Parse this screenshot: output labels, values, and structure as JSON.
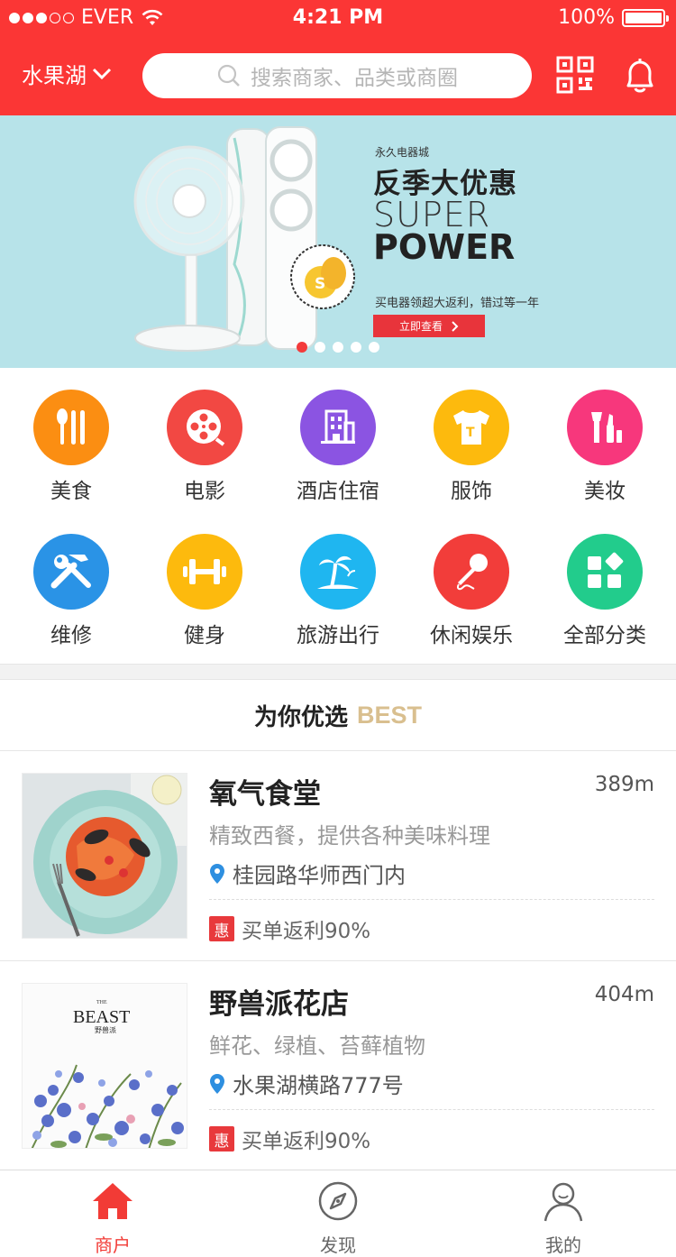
{
  "status_bar": {
    "carrier": "EVER",
    "time": "4:21 PM",
    "battery": "100%"
  },
  "header": {
    "city": "水果湖",
    "search_placeholder": "搜索商家、品类或商圈"
  },
  "banner": {
    "brand": "永久电器城",
    "title": "反季大优惠",
    "super": "SUPER",
    "power": "POWER",
    "desc": "买电器领超大返利，错过等一年",
    "button": "立即查看",
    "slide_count": 5,
    "active_slide": 1
  },
  "categories": [
    {
      "label": "美食",
      "icon": "cutlery-icon",
      "color": "#fb8e12"
    },
    {
      "label": "电影",
      "icon": "film-reel-icon",
      "color": "#f24843"
    },
    {
      "label": "酒店住宿",
      "icon": "building-icon",
      "color": "#8b54e2"
    },
    {
      "label": "服饰",
      "icon": "tshirt-icon",
      "color": "#fdba0d"
    },
    {
      "label": "美妆",
      "icon": "cosmetics-icon",
      "color": "#f7377c"
    },
    {
      "label": "维修",
      "icon": "tools-icon",
      "color": "#2a93e6"
    },
    {
      "label": "健身",
      "icon": "dumbbell-icon",
      "color": "#fdba0d"
    },
    {
      "label": "旅游出行",
      "icon": "palm-tree-icon",
      "color": "#1fb6f0"
    },
    {
      "label": "休闲娱乐",
      "icon": "microphone-icon",
      "color": "#f23d3a"
    },
    {
      "label": "全部分类",
      "icon": "grid-icon",
      "color": "#22cc8c"
    }
  ],
  "section": {
    "title": "为你优选",
    "title_en": "BEST"
  },
  "shops": [
    {
      "name": "氧气食堂",
      "distance": "389m",
      "desc": "精致西餐，提供各种美味料理",
      "address": "桂园路华师西门内",
      "promo_badge": "惠",
      "promo": "买单返利90%"
    },
    {
      "name": "野兽派花店",
      "distance": "404m",
      "desc": "鲜花、绿植、苔藓植物",
      "address": "水果湖横路777号",
      "promo_badge": "惠",
      "promo": "买单返利90%",
      "logo_top": "THE",
      "logo_main": "BEAST",
      "logo_sub": "野兽派"
    }
  ],
  "tabbar": [
    {
      "label": "商户",
      "icon": "home-icon",
      "active": true
    },
    {
      "label": "发现",
      "icon": "compass-icon",
      "active": false
    },
    {
      "label": "我的",
      "icon": "user-icon",
      "active": false
    }
  ],
  "colors": {
    "primary": "#fb3635",
    "banner_bg": "#b7e3e9",
    "best_gold": "#d9bf8f"
  }
}
